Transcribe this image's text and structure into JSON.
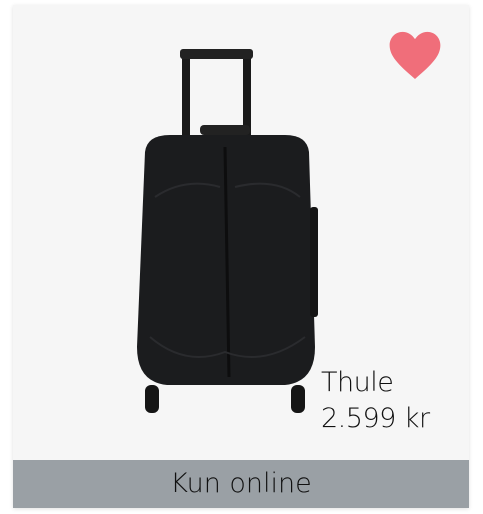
{
  "product": {
    "brand": "Thule",
    "price": "2.599 kr",
    "badge": "Kun online",
    "favorite_icon": "heart-icon",
    "heart_color": "#f06e7a"
  }
}
